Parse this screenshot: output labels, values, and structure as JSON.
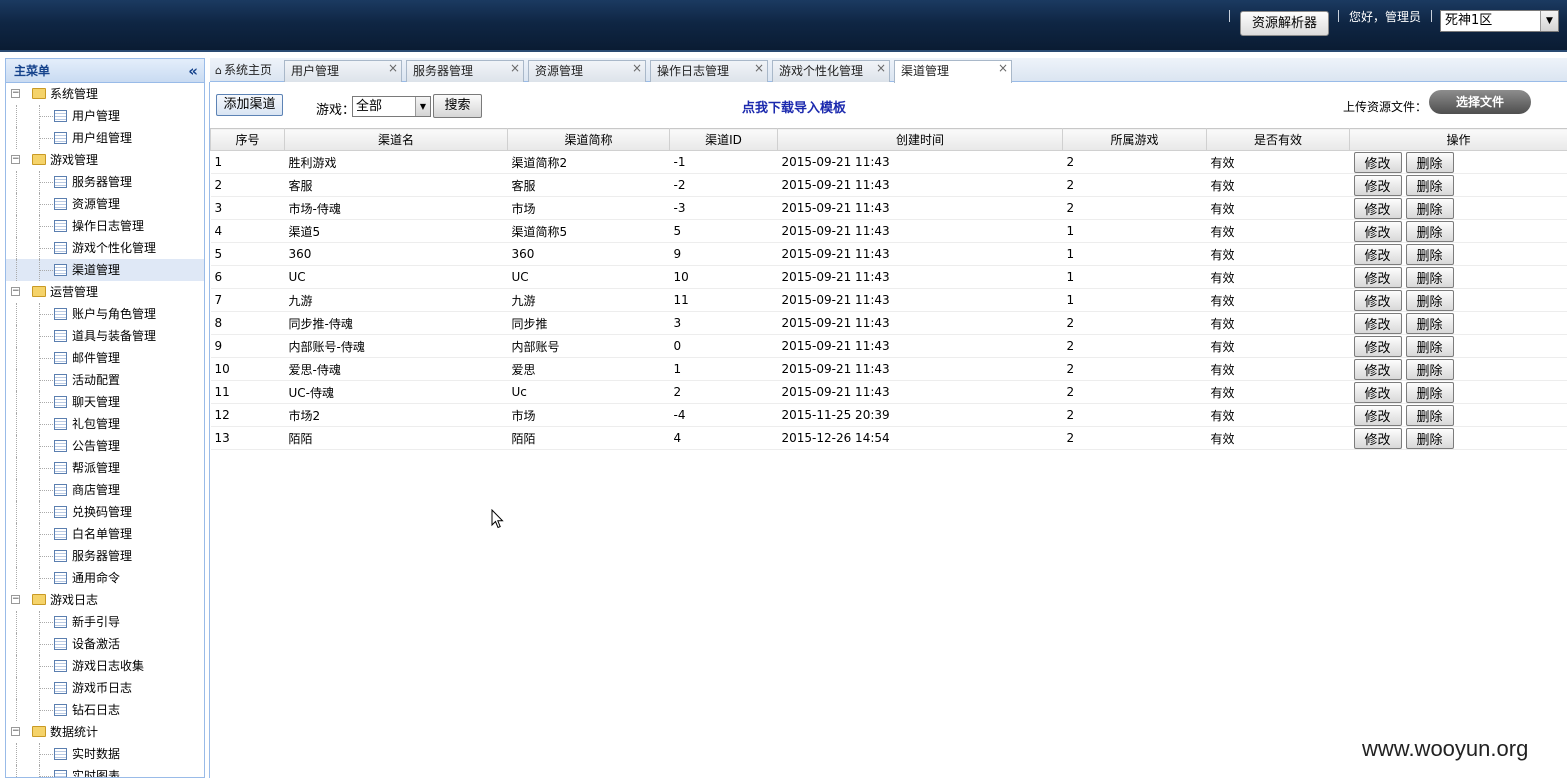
{
  "header": {
    "parser_button": "资源解析器",
    "greeting": "您好，管理员",
    "server_select": "死神1区"
  },
  "sidebar": {
    "title": "主菜单",
    "groups": [
      {
        "label": "系统管理",
        "items": [
          "用户管理",
          "用户组管理"
        ]
      },
      {
        "label": "游戏管理",
        "items": [
          "服务器管理",
          "资源管理",
          "操作日志管理",
          "游戏个性化管理",
          "渠道管理"
        ]
      },
      {
        "label": "运营管理",
        "items": [
          "账户与角色管理",
          "道具与装备管理",
          "邮件管理",
          "活动配置",
          "聊天管理",
          "礼包管理",
          "公告管理",
          "帮派管理",
          "商店管理",
          "兑换码管理",
          "白名单管理",
          "服务器管理",
          "通用命令"
        ]
      },
      {
        "label": "游戏日志",
        "items": [
          "新手引导",
          "设备激活",
          "游戏日志收集",
          "游戏币日志",
          "钻石日志"
        ]
      },
      {
        "label": "数据统计",
        "items": [
          "实时数据",
          "实时图表"
        ]
      }
    ],
    "selected": "渠道管理"
  },
  "tabs": {
    "home": "系统主页",
    "items": [
      "用户管理",
      "服务器管理",
      "资源管理",
      "操作日志管理",
      "游戏个性化管理",
      "渠道管理"
    ],
    "active": "渠道管理"
  },
  "toolbar": {
    "add_button": "添加渠道",
    "game_label": "游戏：",
    "game_select": "全部",
    "search_button": "搜索",
    "download_link": "点我下载导入模板",
    "upload_label": "上传资源文件：",
    "choose_file_button": "选择文件"
  },
  "table": {
    "columns": [
      "序号",
      "渠道名",
      "渠道简称",
      "渠道ID",
      "创建时间",
      "所属游戏",
      "是否有效",
      "操作"
    ],
    "edit_label": "修改",
    "delete_label": "删除",
    "rows": [
      [
        "1",
        "胜利游戏",
        "渠道简称2",
        "-1",
        "2015-09-21 11:43",
        "2",
        "有效"
      ],
      [
        "2",
        "客服",
        "客服",
        "-2",
        "2015-09-21 11:43",
        "2",
        "有效"
      ],
      [
        "3",
        "市场-侍魂",
        "市场",
        "-3",
        "2015-09-21 11:43",
        "2",
        "有效"
      ],
      [
        "4",
        "渠道5",
        "渠道简称5",
        "5",
        "2015-09-21 11:43",
        "1",
        "有效"
      ],
      [
        "5",
        "360",
        "360",
        "9",
        "2015-09-21 11:43",
        "1",
        "有效"
      ],
      [
        "6",
        "UC",
        "UC",
        "10",
        "2015-09-21 11:43",
        "1",
        "有效"
      ],
      [
        "7",
        "九游",
        "九游",
        "11",
        "2015-09-21 11:43",
        "1",
        "有效"
      ],
      [
        "8",
        "同步推-侍魂",
        "同步推",
        "3",
        "2015-09-21 11:43",
        "2",
        "有效"
      ],
      [
        "9",
        "内部账号-侍魂",
        "内部账号",
        "0",
        "2015-09-21 11:43",
        "2",
        "有效"
      ],
      [
        "10",
        "爱思-侍魂",
        "爱思",
        "1",
        "2015-09-21 11:43",
        "2",
        "有效"
      ],
      [
        "11",
        "UC-侍魂",
        "Uc",
        "2",
        "2015-09-21 11:43",
        "2",
        "有效"
      ],
      [
        "12",
        "市场2",
        "市场",
        "-4",
        "2015-11-25 20:39",
        "2",
        "有效"
      ],
      [
        "13",
        "陌陌",
        "陌陌",
        "4",
        "2015-12-26 14:54",
        "2",
        "有效"
      ]
    ]
  },
  "watermark": "www.wooyun.org"
}
